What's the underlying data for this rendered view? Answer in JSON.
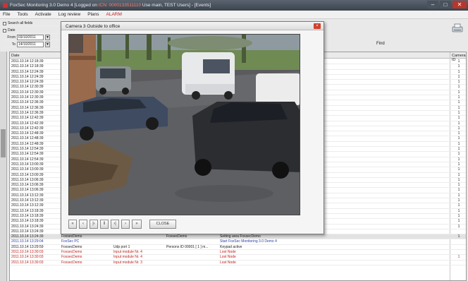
{
  "window": {
    "title_prefix": "FoxSec Monitoring 3.0 Demo 4 [Logged on ",
    "title_warn": "ICN: 0000133511110",
    "title_suffix": "Use main, TEST Users] - [Events]"
  },
  "menu": [
    "File",
    "Tools",
    "Activate",
    "Log review",
    "Plans",
    "ALARM"
  ],
  "filter": {
    "search_all_label": "Search all fields",
    "date_group_label": "Date",
    "from_label": "From",
    "from_value": "03/10/2011",
    "to_label": "To",
    "to_value": "14/10/2011"
  },
  "find_label": "Find",
  "table": {
    "columns": {
      "date": "Date",
      "camera_id": "Camera ID"
    },
    "rows": [
      {
        "date": "2011.10.14  12:18:39",
        "user": "",
        "unit": "",
        "person": "",
        "event": "",
        "cam": "1",
        "style": ""
      },
      {
        "date": "2011.10.14  12:18:39",
        "user": "",
        "unit": "",
        "person": "",
        "event": "",
        "cam": "1",
        "style": ""
      },
      {
        "date": "2011.10.14  12:24:39",
        "user": "",
        "unit": "",
        "person": "",
        "event": "",
        "cam": "1",
        "style": ""
      },
      {
        "date": "2011.10.14  12:24:39",
        "user": "",
        "unit": "",
        "person": "",
        "event": "",
        "cam": "1",
        "style": ""
      },
      {
        "date": "2011.10.14  12:24:39",
        "user": "",
        "unit": "",
        "person": "",
        "event": "",
        "cam": "1",
        "style": ""
      },
      {
        "date": "2011.10.14  12:30:39",
        "user": "",
        "unit": "",
        "person": "",
        "event": "",
        "cam": "1",
        "style": ""
      },
      {
        "date": "2011.10.14  12:30:39",
        "user": "",
        "unit": "",
        "person": "",
        "event": "",
        "cam": "1",
        "style": ""
      },
      {
        "date": "2011.10.14  12:30:39",
        "user": "",
        "unit": "",
        "person": "",
        "event": "",
        "cam": "1",
        "style": ""
      },
      {
        "date": "2011.10.14  12:36:39",
        "user": "",
        "unit": "",
        "person": "",
        "event": "",
        "cam": "1",
        "style": ""
      },
      {
        "date": "2011.10.14  12:36:39",
        "user": "",
        "unit": "",
        "person": "",
        "event": "",
        "cam": "1",
        "style": ""
      },
      {
        "date": "2011.10.14  12:36:39",
        "user": "",
        "unit": "",
        "person": "",
        "event": "",
        "cam": "1",
        "style": ""
      },
      {
        "date": "2011.10.14  12:42:39",
        "user": "",
        "unit": "",
        "person": "",
        "event": "",
        "cam": "1",
        "style": ""
      },
      {
        "date": "2011.10.14  12:42:39",
        "user": "",
        "unit": "",
        "person": "",
        "event": "",
        "cam": "1",
        "style": ""
      },
      {
        "date": "2011.10.14  12:42:39",
        "user": "",
        "unit": "",
        "person": "",
        "event": "",
        "cam": "1",
        "style": ""
      },
      {
        "date": "2011.10.14  12:48:39",
        "user": "",
        "unit": "",
        "person": "",
        "event": "",
        "cam": "1",
        "style": ""
      },
      {
        "date": "2011.10.14  12:48:39",
        "user": "",
        "unit": "",
        "person": "",
        "event": "",
        "cam": "1",
        "style": ""
      },
      {
        "date": "2011.10.14  12:48:39",
        "user": "",
        "unit": "",
        "person": "",
        "event": "",
        "cam": "1",
        "style": ""
      },
      {
        "date": "2011.10.14  12:54:39",
        "user": "",
        "unit": "",
        "person": "",
        "event": "",
        "cam": "1",
        "style": ""
      },
      {
        "date": "2011.10.14  12:54:39",
        "user": "",
        "unit": "",
        "person": "",
        "event": "",
        "cam": "1",
        "style": ""
      },
      {
        "date": "2011.10.14  12:54:39",
        "user": "",
        "unit": "",
        "person": "",
        "event": "",
        "cam": "1",
        "style": ""
      },
      {
        "date": "2011.10.14  13:00:39",
        "user": "",
        "unit": "",
        "person": "",
        "event": "",
        "cam": "1",
        "style": ""
      },
      {
        "date": "2011.10.14  13:00:39",
        "user": "",
        "unit": "",
        "person": "",
        "event": "",
        "cam": "1",
        "style": ""
      },
      {
        "date": "2011.10.14  13:00:39",
        "user": "",
        "unit": "",
        "person": "",
        "event": "",
        "cam": "1",
        "style": ""
      },
      {
        "date": "2011.10.14  13:06:39",
        "user": "",
        "unit": "",
        "person": "",
        "event": "",
        "cam": "1",
        "style": ""
      },
      {
        "date": "2011.10.14  13:06:39",
        "user": "",
        "unit": "",
        "person": "",
        "event": "",
        "cam": "1",
        "style": ""
      },
      {
        "date": "2011.10.14  13:06:39",
        "user": "",
        "unit": "",
        "person": "",
        "event": "",
        "cam": "1",
        "style": ""
      },
      {
        "date": "2011.10.14  13:12:39",
        "user": "",
        "unit": "",
        "person": "",
        "event": "",
        "cam": "1",
        "style": ""
      },
      {
        "date": "2011.10.14  13:12:39",
        "user": "",
        "unit": "",
        "person": "",
        "event": "",
        "cam": "1",
        "style": ""
      },
      {
        "date": "2011.10.14  13:12:39",
        "user": "",
        "unit": "",
        "person": "",
        "event": "",
        "cam": "1",
        "style": ""
      },
      {
        "date": "2011.10.14  13:18:39",
        "user": "",
        "unit": "",
        "person": "",
        "event": "",
        "cam": "1",
        "style": ""
      },
      {
        "date": "2011.10.14  13:18:39",
        "user": "",
        "unit": "",
        "person": "",
        "event": "",
        "cam": "1",
        "style": ""
      },
      {
        "date": "2011.10.14  13:18:39",
        "user": "FoxsecDemo",
        "unit": "",
        "person": "",
        "event": "Setting area FoxsecDemo",
        "cam": "1",
        "style": ""
      },
      {
        "date": "2011.10.14  13:24:39",
        "user": "FoxsecDemo",
        "unit": "FoxsecDemo",
        "person": "FoxsecDemo",
        "event": "execute program",
        "cam": "1",
        "style": ""
      },
      {
        "date": "2011.10.14  13:24:39",
        "user": "FoxsecDemo",
        "unit": "",
        "person": "",
        "event": "The program Arm Area 1",
        "cam": "",
        "style": ""
      },
      {
        "date": "2011.10.14  13:24:39",
        "user": "FoxsecDemo",
        "unit": "",
        "person": "FoxsecDemo",
        "event": "Setting area FoxsecDemo",
        "cam": "1",
        "style": "hl"
      },
      {
        "date": "2011.10.14  13:29:04",
        "user": "FoxSec PC",
        "unit": "",
        "person": "",
        "event": "Start FoxSec Monitoring 3.0 Demo 4",
        "cam": "",
        "style": "blue"
      },
      {
        "date": "2011.10.14  13:29:59",
        "user": "FoxsecDemo",
        "unit": "Udp port 1",
        "person": "Persons ID 00001 [ 1 ] m...",
        "event": "Keypad active",
        "cam": "",
        "style": ""
      },
      {
        "date": "2011.10.14  13:30:03",
        "user": "FoxsecDemo",
        "unit": "Input module Nr. 4",
        "person": "",
        "event": "Lost Node",
        "cam": "",
        "style": "red"
      },
      {
        "date": "2011.10.14  13:30:03",
        "user": "FoxsecDemo",
        "unit": "Input module Nr. 4",
        "person": "",
        "event": "Lost Node",
        "cam": "1",
        "style": "red"
      },
      {
        "date": "2011.10.14  13:30:03",
        "user": "FoxsecDemo",
        "unit": "Input module Nr. 3",
        "person": "",
        "event": "Lost Node",
        "cam": "",
        "style": "red"
      }
    ]
  },
  "camera_dialog": {
    "title": "Camera 3 Outside to office",
    "close_x": "×",
    "controls": [
      "«",
      "‹",
      "|‹",
      "‖",
      "›|",
      "›",
      "»"
    ],
    "close_label": "CLOSE"
  }
}
